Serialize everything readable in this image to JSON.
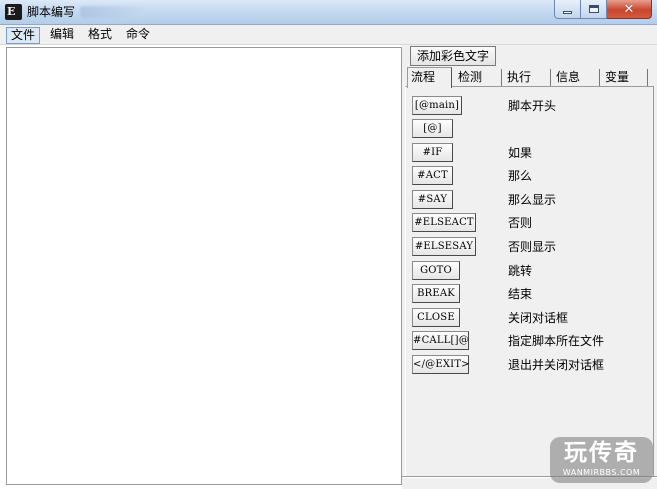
{
  "window": {
    "icon_text": "E",
    "title": "脚本编写",
    "minimize_glyph": "",
    "close_glyph": "✕"
  },
  "menu": {
    "items": [
      {
        "label": "文件"
      },
      {
        "label": "编辑"
      },
      {
        "label": "格式"
      },
      {
        "label": "命令"
      }
    ]
  },
  "side": {
    "add_color_text_label": "添加彩色文字",
    "tabs": [
      {
        "label": "流程",
        "active": true
      },
      {
        "label": "检测",
        "active": false
      },
      {
        "label": "执行",
        "active": false
      },
      {
        "label": "信息",
        "active": false
      },
      {
        "label": "变量",
        "active": false
      }
    ],
    "commands": [
      {
        "button": "[@main]",
        "desc": "脚本开头"
      },
      {
        "button": "[@]",
        "desc": ""
      },
      {
        "button": "#IF",
        "desc": "如果"
      },
      {
        "button": "#ACT",
        "desc": "那么"
      },
      {
        "button": "#SAY",
        "desc": "那么显示"
      },
      {
        "button": "#ELSEACT",
        "desc": "否则"
      },
      {
        "button": "#ELSESAY",
        "desc": "否则显示"
      },
      {
        "button": "GOTO",
        "desc": "跳转"
      },
      {
        "button": "BREAK",
        "desc": "结束"
      },
      {
        "button": "CLOSE",
        "desc": "关闭对话框"
      },
      {
        "button": "#CALL[]@",
        "desc": "指定脚本所在文件"
      },
      {
        "button": "</@EXIT>",
        "desc": "退出并关闭对话框"
      }
    ]
  },
  "watermark": {
    "main": "玩传奇",
    "sub": "WANMIRBBS.COM"
  }
}
